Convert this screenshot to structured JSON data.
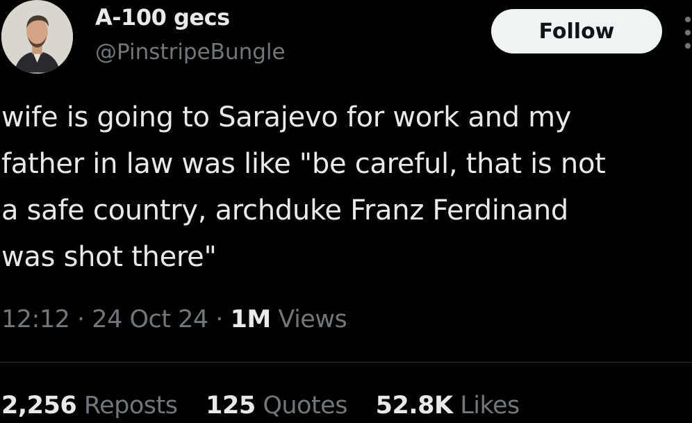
{
  "author": {
    "name": "A-100 gecs",
    "handle": "@PinstripeBungle"
  },
  "follow_button": {
    "label": "Follow"
  },
  "more_icon": "more-vertical-icon",
  "tweet": {
    "text": "wife is going to Sarajevo for work and my\nfather in law was like \"be careful, that is not\na safe country, archduke Franz Ferdinand\nwas shot there\""
  },
  "meta": {
    "time": "12:12",
    "separator": "·",
    "date": "24 Oct 24",
    "views_count": "1M",
    "views_label": "Views"
  },
  "stats": {
    "reposts_count": "2,256",
    "reposts_label": "Reposts",
    "quotes_count": "125",
    "quotes_label": "Quotes",
    "likes_count": "52.8K",
    "likes_label": "Likes"
  },
  "colors": {
    "background": "#000000",
    "primary_text": "#e7e9ea",
    "secondary_text": "#71767b",
    "button_bg": "#eff3f4",
    "divider": "#2f3336"
  }
}
